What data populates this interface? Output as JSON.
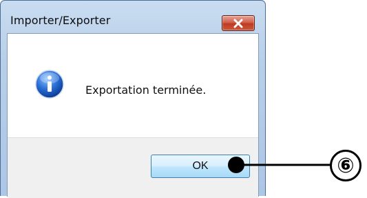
{
  "window": {
    "title": "Importer/Exporter"
  },
  "dialog": {
    "icon": "info-icon",
    "message": "Exportation terminée.",
    "ok_label": "OK"
  },
  "annotation": {
    "callout": "⑥"
  },
  "colors": {
    "titlebar": "#b8cfe9",
    "close_button": "#c84a30",
    "button_area": "#f0f0f0",
    "ok_button_border": "#3c7fb1"
  }
}
